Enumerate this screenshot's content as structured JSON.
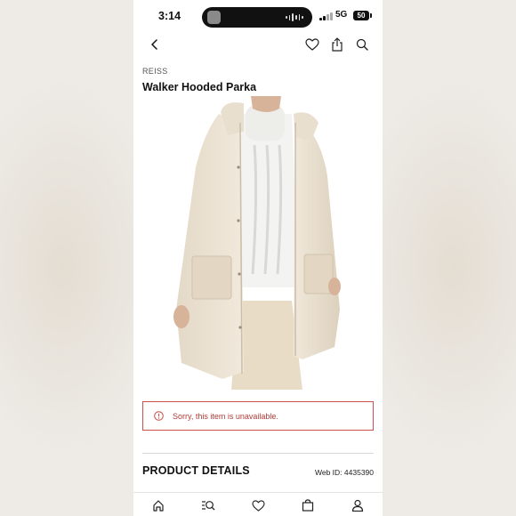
{
  "status_bar": {
    "time": "3:14",
    "network": "5G",
    "battery": "50"
  },
  "nav": {
    "back_icon": "chevron-left-icon",
    "wishlist_icon": "heart-icon",
    "share_icon": "share-icon",
    "search_icon": "search-icon"
  },
  "product": {
    "brand": "REISS",
    "title": "Walker Hooded Parka",
    "image": "product-photo-parka"
  },
  "alert": {
    "message": "Sorry, this item is unavailable.",
    "color": "#c9504c"
  },
  "details": {
    "heading": "PRODUCT DETAILS",
    "web_id": "Web ID: 4435390"
  },
  "tab_bar": {
    "items": [
      "home-icon",
      "search-list-icon",
      "heart-icon",
      "bag-icon",
      "account-icon"
    ]
  }
}
